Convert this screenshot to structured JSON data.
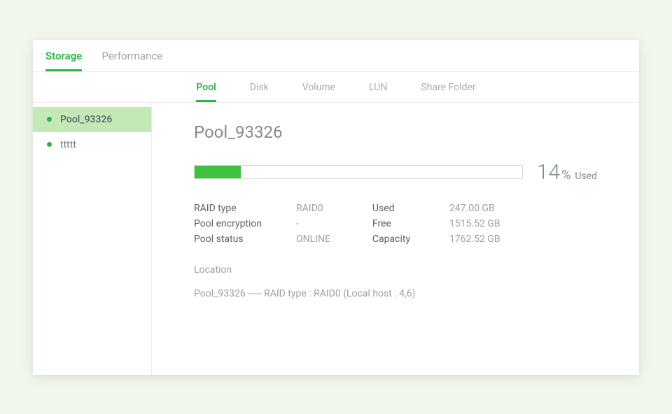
{
  "topTabs": {
    "storage": "Storage",
    "performance": "Performance"
  },
  "subTabs": {
    "pool": "Pool",
    "disk": "Disk",
    "volume": "Volume",
    "lun": "LUN",
    "shareFolder": "Share Folder"
  },
  "sidebar": {
    "items": [
      {
        "label": "Pool_93326"
      },
      {
        "label": "ttttt"
      }
    ]
  },
  "main": {
    "title": "Pool_93326",
    "usage": {
      "percentNumber": "14",
      "percentSymbol": "%",
      "usedLabel": "Used",
      "barWidth": "14%"
    },
    "infoLeft": {
      "raidTypeLabel": "RAID type",
      "raidTypeValue": "RAID0",
      "encryptionLabel": "Pool encryption",
      "encryptionValue": "-",
      "statusLabel": "Pool status",
      "statusValue": "ONLINE"
    },
    "infoRight": {
      "usedLabel": "Used",
      "usedValue": "247.00 GB",
      "freeLabel": "Free",
      "freeValue": "1515.52 GB",
      "capacityLabel": "Capacity",
      "capacityValue": "1762.52 GB"
    },
    "locationHeader": "Location",
    "locationText": "Pool_93326 ----- RAID type : RAID0 (Local host : 4,6)"
  }
}
